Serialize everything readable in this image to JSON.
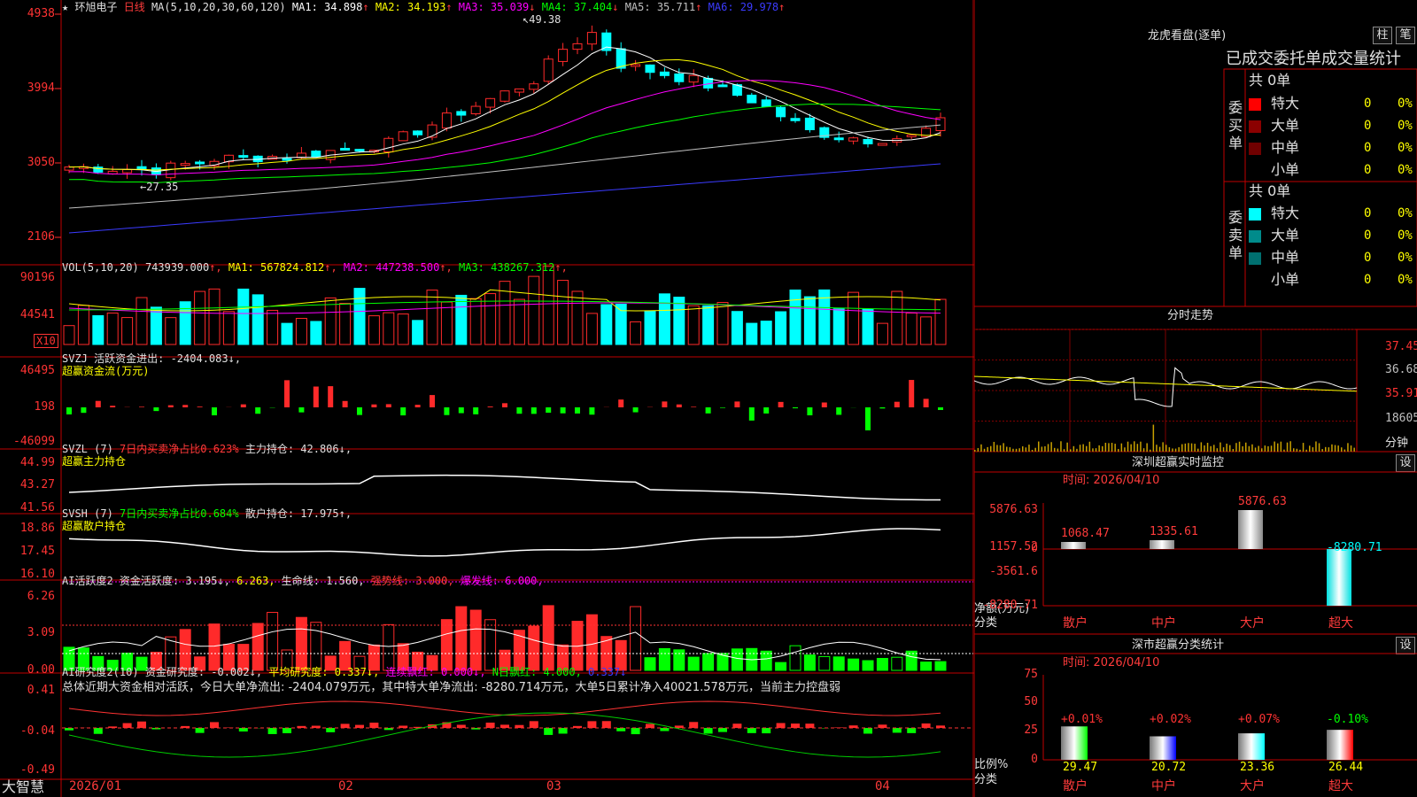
{
  "stock": {
    "title": "★ 环旭电子",
    "period": "日线"
  },
  "main": {
    "ma_title": "MA(5,10,20,30,60,120)",
    "ma": [
      {
        "label": "MA1:",
        "value": "34.898",
        "arrow": "↑",
        "color": "#ffffff"
      },
      {
        "label": "MA2:",
        "value": "34.193",
        "arrow": "↑",
        "color": "#ffff00"
      },
      {
        "label": "MA3:",
        "value": "35.039",
        "arrow": "↓",
        "color": "#ff00ff"
      },
      {
        "label": "MA4:",
        "value": "37.404",
        "arrow": "↓",
        "color": "#00ff00"
      },
      {
        "label": "MA5:",
        "value": "35.711",
        "arrow": "↑",
        "color": "#c0c0c0"
      },
      {
        "label": "MA6:",
        "value": "29.978",
        "arrow": "↑",
        "color": "#3b3bff"
      }
    ],
    "y_labels": [
      "4938",
      "3994",
      "3050",
      "2106"
    ],
    "high_label": "49.38",
    "low_label": "27.35"
  },
  "vol": {
    "title": "VOL(5,10,20)",
    "value": "743939.000",
    "ma": [
      {
        "label": "MA1:",
        "value": "567824.812",
        "arrow": "↑",
        "color": "#ffff00"
      },
      {
        "label": "MA2:",
        "value": "447238.500",
        "arrow": "↑",
        "color": "#ff00ff"
      },
      {
        "label": "MA3:",
        "value": "438267.312",
        "arrow": "↑",
        "color": "#00ff00"
      }
    ],
    "y_labels": [
      "90196",
      "44541"
    ],
    "unit": "X10"
  },
  "svzj": {
    "line1": "SVZJ  活跃资金进出: -2404.083↓,",
    "line2": "超赢资金流(万元)",
    "y_labels": [
      "46495",
      "198",
      "-46099"
    ]
  },
  "svzl": {
    "name": "SVZL (7) ",
    "label_a": "7日内买卖净占比0.623%",
    "label_b": " 主力持仓: 42.806↓,",
    "line2": "超赢主力持仓",
    "y_labels": [
      "44.99",
      "43.27",
      "41.56"
    ]
  },
  "svsh": {
    "name": "SVSH (7) ",
    "label_a": "7日内买卖净占比0.684%",
    "label_b": " 散户持仓: 17.975↑,",
    "line2": "超赢散户持仓",
    "y_labels": [
      "18.86",
      "17.45",
      "16.10"
    ]
  },
  "ai1": {
    "name": "AI活跃度2 ",
    "t1": "资金活跃度: 3.195↓,",
    "t2": " 6.263,",
    "t3": " 生命线: 1.560,",
    "t4": " 强势线: 3.000,",
    "t5": " 爆发线: 6.000,",
    "y_labels": [
      "6.26",
      "3.09",
      "0.00"
    ]
  },
  "ai2": {
    "name": "AI研究度2(10) ",
    "t1": "资金研究度: -0.002↓,",
    "t2": " 平均研究度: 0.337↓,",
    "t3": " 连续飘红: 0.000↓,",
    "t4": " N日飘红: 4.000,",
    "t5": " 0.337↓",
    "summary": "总体近期大资金相对活跃，今日大单净流出: -2404.079万元，其中特大单净流出: -8280.714万元，大单5日累计净入40021.578万元，当前主力控盘弱",
    "y_labels": [
      "0.41",
      "-0.04",
      "-0.49"
    ]
  },
  "xaxis": {
    "labels": [
      "2026/01",
      "02",
      "03",
      "04"
    ],
    "brand": "大智慧"
  },
  "longhu": {
    "title": "龙虎看盘(逐单)",
    "btn1": "柱",
    "btn2": "笔",
    "header": "已成交委托单成交量统计",
    "buy_side": "委买单",
    "sell_side": "委卖单",
    "buy_total": "共 0单",
    "sell_total": "共 0单",
    "buy_rows": [
      {
        "name": "特大",
        "vol": "0",
        "pct": "0%",
        "color": "#ff0000"
      },
      {
        "name": "大单",
        "vol": "0",
        "pct": "0%",
        "color": "#8b0000"
      },
      {
        "name": "中单",
        "vol": "0",
        "pct": "0%",
        "color": "#700000"
      },
      {
        "name": "小单",
        "vol": "0",
        "pct": "0%",
        "color": ""
      }
    ],
    "sell_rows": [
      {
        "name": "特大",
        "vol": "0",
        "pct": "0%",
        "color": "#00ffff"
      },
      {
        "name": "大单",
        "vol": "0",
        "pct": "0%",
        "color": "#008b8b"
      },
      {
        "name": "中单",
        "vol": "0",
        "pct": "0%",
        "color": "#007070"
      },
      {
        "name": "小单",
        "vol": "0",
        "pct": "0%",
        "color": ""
      }
    ]
  },
  "fenshi": {
    "title": "分时走势",
    "y_labels": [
      "37.45",
      "36.68",
      "35.91",
      "18605"
    ],
    "unit": "分钟"
  },
  "monitor": {
    "title": "深圳超赢实时监控",
    "btn": "设",
    "time": "时间: 2026/04/10",
    "y_labels": [
      "5876.63",
      "1157.52",
      "0",
      "-3561.6",
      "-8280.71"
    ],
    "ylabel": "净额(万元)",
    "xlabel": "分类",
    "categories": [
      "散户",
      "中户",
      "大户",
      "超大"
    ],
    "value_labels": [
      "1068.47",
      "1335.61",
      "5876.63",
      "-8280.71"
    ]
  },
  "classify": {
    "title": "深市超赢分类统计",
    "btn": "设",
    "time": "时间: 2026/04/10",
    "y_labels": [
      "75",
      "50",
      "25",
      "0"
    ],
    "ylabel": "比例%",
    "xlabel": "分类",
    "categories": [
      "散户",
      "中户",
      "大户",
      "超大"
    ],
    "pct_labels": [
      "+0.01%",
      "+0.02%",
      "+0.07%",
      "-0.10%"
    ],
    "values": [
      "29.47",
      "20.72",
      "23.36",
      "26.44"
    ]
  },
  "chart_data": [
    {
      "type": "bar",
      "title": "深圳超赢实时监控",
      "categories": [
        "散户",
        "中户",
        "大户",
        "超大"
      ],
      "values": [
        1068.47,
        1335.61,
        5876.63,
        -8280.71
      ],
      "ylabel": "净额(万元)",
      "xlabel": "分类",
      "ylim": [
        -8280.71,
        5876.63
      ]
    },
    {
      "type": "bar",
      "title": "深市超赢分类统计",
      "categories": [
        "散户",
        "中户",
        "大户",
        "超大"
      ],
      "values": [
        29.47,
        20.72,
        23.36,
        26.44
      ],
      "ylabel": "比例%",
      "xlabel": "分类",
      "ylim": [
        0,
        75
      ]
    }
  ]
}
